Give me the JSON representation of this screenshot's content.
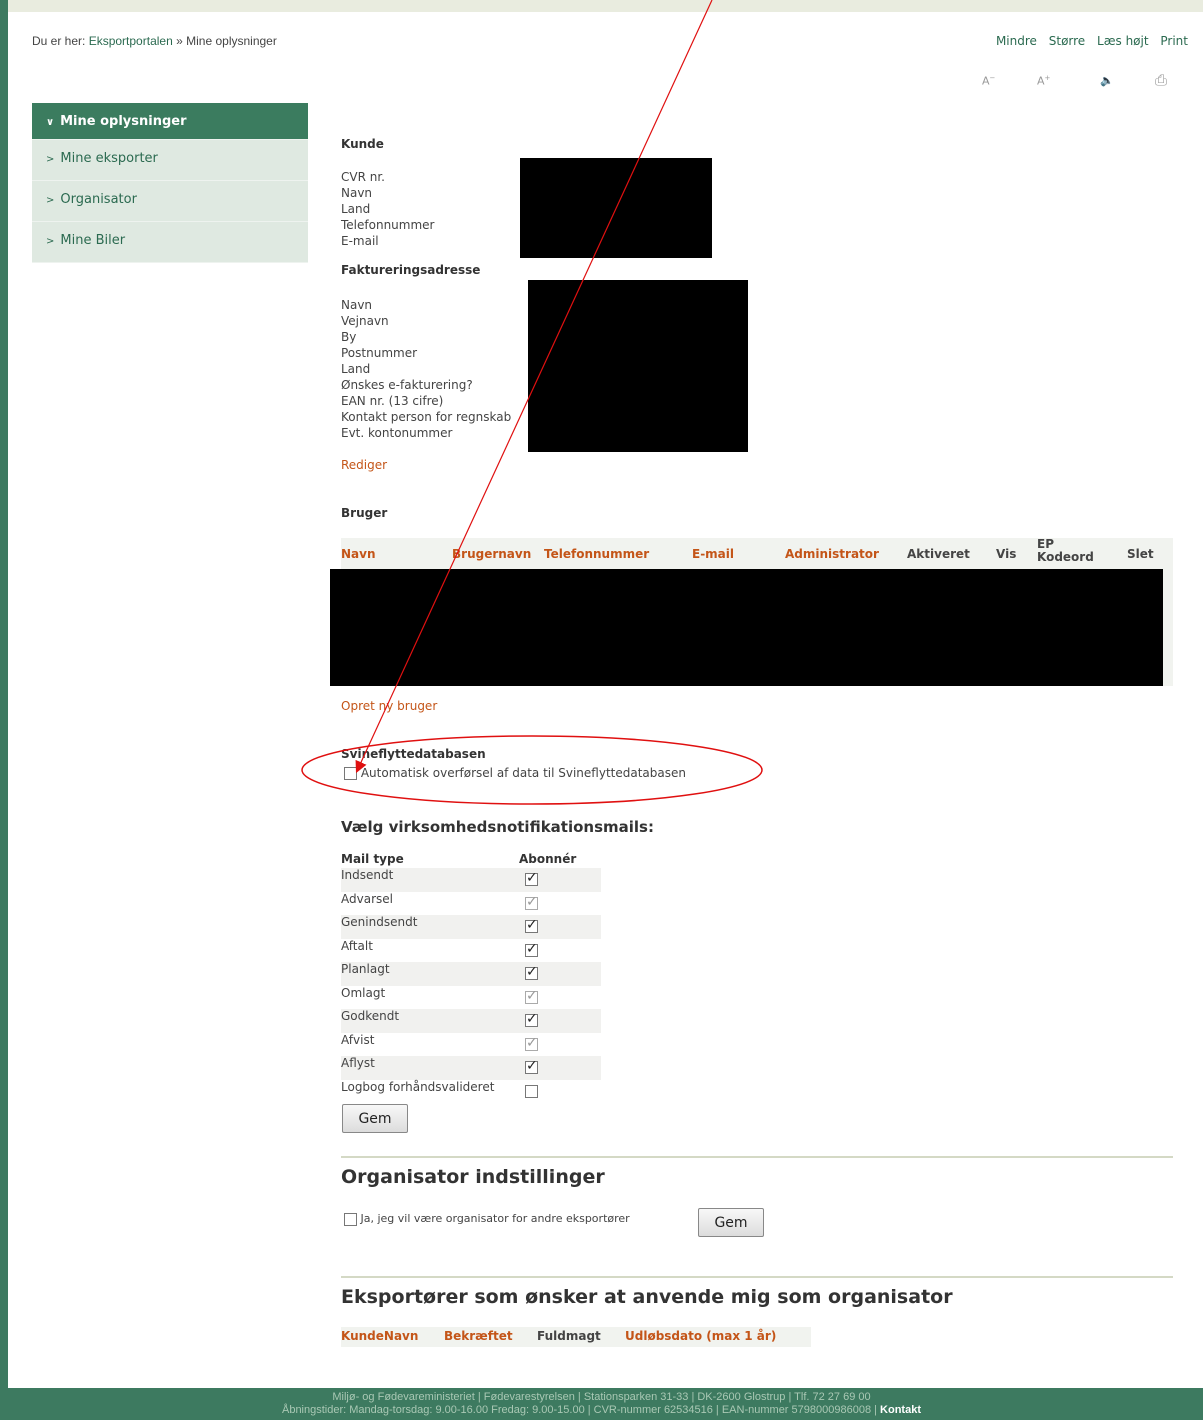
{
  "breadcrumb": {
    "prefix": "Du er her:",
    "home": "Eksportportalen",
    "sep": "»",
    "current": "Mine oplysninger"
  },
  "tools": {
    "smaller": "Mindre",
    "larger": "Større",
    "read": "Læs højt",
    "print": "Print"
  },
  "sidebar": {
    "items": [
      {
        "label": "Mine oplysninger",
        "active": true
      },
      {
        "label": "Mine eksporter"
      },
      {
        "label": "Organisator"
      },
      {
        "label": "Mine Biler"
      }
    ]
  },
  "kunde": {
    "title": "Kunde",
    "fields": [
      "CVR nr.",
      "Navn",
      "Land",
      "Telefonnummer",
      "E-mail"
    ]
  },
  "faktura": {
    "title": "Faktureringsadresse",
    "fields": [
      "Navn",
      "Vejnavn",
      "By",
      "Postnummer",
      "Land",
      "Ønskes e-fakturering?",
      "EAN nr. (13 cifre)",
      "Kontakt person for regnskab",
      "Evt. kontonummer"
    ],
    "edit": "Rediger"
  },
  "bruger": {
    "title": "Bruger",
    "columns": [
      "Navn",
      "Brugernavn",
      "Telefonnummer",
      "E-mail",
      "Administrator",
      "Aktiveret",
      "Vis",
      "EP Kodeord",
      "Slet"
    ],
    "ep1": "EP",
    "ep2": "Kodeord",
    "create": "Opret ny bruger"
  },
  "svine": {
    "title": "Svineflyttedatabasen",
    "checkbox_label": "Automatisk overførsel af data til Svineflyttedatabasen",
    "checked": false
  },
  "notifications": {
    "title": "Vælg virksomhedsnotifikationsmails:",
    "col_type": "Mail type",
    "col_sub": "Abonnér",
    "rows": [
      {
        "label": "Indsendt",
        "checked": true,
        "disabled": false
      },
      {
        "label": "Advarsel",
        "checked": true,
        "disabled": true
      },
      {
        "label": "Genindsendt",
        "checked": true,
        "disabled": false
      },
      {
        "label": "Aftalt",
        "checked": true,
        "disabled": false
      },
      {
        "label": "Planlagt",
        "checked": true,
        "disabled": false
      },
      {
        "label": "Omlagt",
        "checked": true,
        "disabled": true
      },
      {
        "label": "Godkendt",
        "checked": true,
        "disabled": false
      },
      {
        "label": "Afvist",
        "checked": true,
        "disabled": true
      },
      {
        "label": "Aflyst",
        "checked": true,
        "disabled": false
      },
      {
        "label": "Logbog forhåndsvalideret",
        "checked": false,
        "disabled": false
      }
    ],
    "save": "Gem"
  },
  "organisator": {
    "title": "Organisator indstillinger",
    "checkbox_label": "Ja, jeg vil være organisator for andre eksportører",
    "save": "Gem"
  },
  "eksportorer": {
    "title": "Eksportører som ønsker at anvende mig som organisator",
    "columns": [
      "KundeNavn",
      "Bekræftet",
      "Fuldmagt",
      "Udløbsdato (max 1 år)"
    ]
  },
  "footer": {
    "line1": "Miljø- og Fødevareministeriet | Fødevarestyrelsen | Stationsparken 31-33 | DK-2600 Glostrup | Tlf. 72 27 69 00",
    "line2": "Åbningstider: Mandag-torsdag: 9.00-16.00 Fredag: 9.00-15.00 | CVR-nummer 62534516 | EAN-nummer 5798000986008 |",
    "contact": "Kontakt"
  },
  "colors": {
    "brand_green": "#3d7a60",
    "link_orange": "#c45518",
    "annotation_red": "#e01010"
  }
}
